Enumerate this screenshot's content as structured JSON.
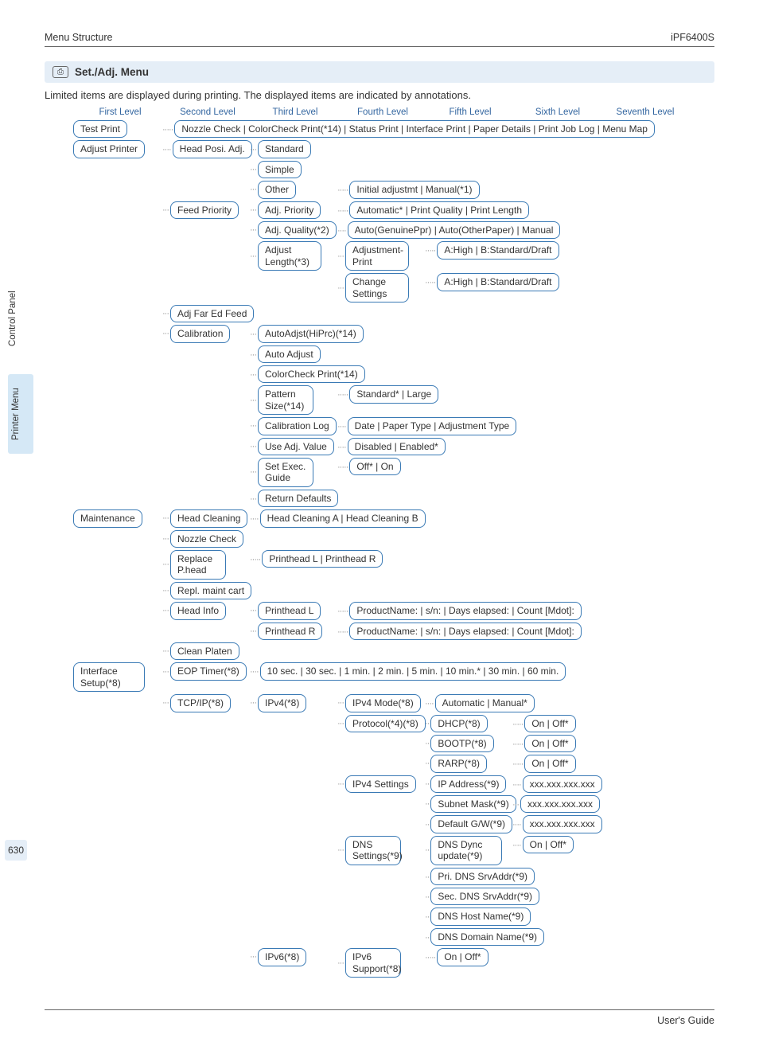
{
  "header": {
    "left": "Menu Structure",
    "right": "iPF6400S"
  },
  "sideTabs": {
    "tab1": "Control Panel",
    "tab2": "Printer Menu"
  },
  "pageNumber": "630",
  "footer": "User's Guide",
  "section": {
    "iconGlyph": "⎙",
    "title": "Set./Adj. Menu",
    "intro": "Limited items are displayed during printing. The displayed items are indicated by annotations."
  },
  "levels": [
    "First Level",
    "Second Level",
    "Third Level",
    "Fourth Level",
    "Fifth Level",
    "Sixth Level",
    "Seventh Level"
  ],
  "tree": {
    "testPrint": {
      "l1": "Test Print",
      "l2": "Nozzle Check | ColorCheck Print(*14) | Status Print | Interface Print | Paper Details | Print Job Log | Menu Map"
    },
    "adjustPrinter": {
      "l1": "Adjust Printer",
      "headPosi": {
        "l2": "Head Posi. Adj.",
        "standard": "Standard",
        "simple": "Simple",
        "other": "Other",
        "otherL4": "Initial adjustmt | Manual(*1)"
      },
      "feedPriority": {
        "l2": "Feed Priority",
        "adjPriority": {
          "l3": "Adj. Priority",
          "l4": "Automatic* | Print Quality | Print Length"
        },
        "adjQuality": {
          "l3": "Adj. Quality(*2)",
          "l4": "Auto(GenuinePpr) | Auto(OtherPaper) | Manual"
        },
        "adjustLength": {
          "l3": "Adjust Length(*3)",
          "adjPrint": {
            "l4": "Adjustment-Print",
            "l5": "A:High | B:Standard/Draft"
          },
          "changeSettings": {
            "l4": "Change Settings",
            "l5": "A:High | B:Standard/Draft"
          }
        }
      },
      "adjFarEd": "Adj Far Ed Feed",
      "calibration": {
        "l2": "Calibration",
        "autoAdjHi": "AutoAdjst(HiPrc)(*14)",
        "autoAdjust": "Auto Adjust",
        "ccPrint": "ColorCheck Print(*14)",
        "patternSize": {
          "l3": "Pattern Size(*14)",
          "l4": "Standard* | Large"
        },
        "calibLog": {
          "l3": "Calibration Log",
          "l4": "Date | Paper Type | Adjustment Type"
        },
        "useAdj": {
          "l3": "Use Adj. Value",
          "l4": "Disabled | Enabled*"
        },
        "setExec": {
          "l3": "Set Exec. Guide",
          "l4": "Off* | On"
        },
        "returnDefaults": "Return Defaults"
      }
    },
    "maintenance": {
      "l1": "Maintenance",
      "headCleaning": {
        "l2": "Head Cleaning",
        "l3": "Head Cleaning A | Head Cleaning B"
      },
      "nozzleCheck": "Nozzle Check",
      "replacePhead": {
        "l2": "Replace P.head",
        "l3": "Printhead L | Printhead R"
      },
      "replMaintCart": "Repl. maint cart",
      "headInfo": {
        "l2": "Head Info",
        "phL": {
          "l3": "Printhead L",
          "l4": "ProductName: | s/n: | Days elapsed: | Count [Mdot]:"
        },
        "phR": {
          "l3": "Printhead R",
          "l4": "ProductName: | s/n: | Days elapsed: | Count [Mdot]:"
        }
      },
      "cleanPlaten": "Clean Platen"
    },
    "interfaceSetup": {
      "l1": "Interface Setup(*8)",
      "eopTimer": {
        "l2": "EOP Timer(*8)",
        "l3": "10 sec. | 30 sec. | 1 min. | 2 min. | 5 min. | 10 min.* | 30 min. | 60 min."
      },
      "tcpip": {
        "l2": "TCP/IP(*8)",
        "ipv4": {
          "l3": "IPv4(*8)",
          "ipv4Mode": {
            "l4": "IPv4 Mode(*8)",
            "l5": "Automatic | Manual*"
          },
          "protocol": {
            "l4": "Protocol(*4)(*8)",
            "dhcp": {
              "l5": "DHCP(*8)",
              "l6": "On | Off*"
            },
            "bootp": {
              "l5": "BOOTP(*8)",
              "l6": "On | Off*"
            },
            "rarp": {
              "l5": "RARP(*8)",
              "l6": "On | Off*"
            }
          },
          "ipv4Settings": {
            "l4": "IPv4 Settings",
            "ip": {
              "l5": "IP Address(*9)",
              "l6": "xxx.xxx.xxx.xxx"
            },
            "subnet": {
              "l5": "Subnet Mask(*9)",
              "l6": "xxx.xxx.xxx.xxx"
            },
            "gw": {
              "l5": "Default G/W(*9)",
              "l6": "xxx.xxx.xxx.xxx"
            }
          },
          "dnsSettings": {
            "l4": "DNS Settings(*9)",
            "dyncUp": {
              "l5": "DNS Dync update(*9)",
              "l6": "On | Off*"
            },
            "priDns": "Pri. DNS SrvAddr(*9)",
            "secDns": "Sec. DNS SrvAddr(*9)",
            "hostName": "DNS Host Name(*9)",
            "domainName": "DNS Domain Name(*9)"
          }
        },
        "ipv6": {
          "l3": "IPv6(*8)",
          "support": {
            "l4": "IPv6 Support(*8)",
            "l5": "On | Off*"
          }
        }
      }
    }
  }
}
